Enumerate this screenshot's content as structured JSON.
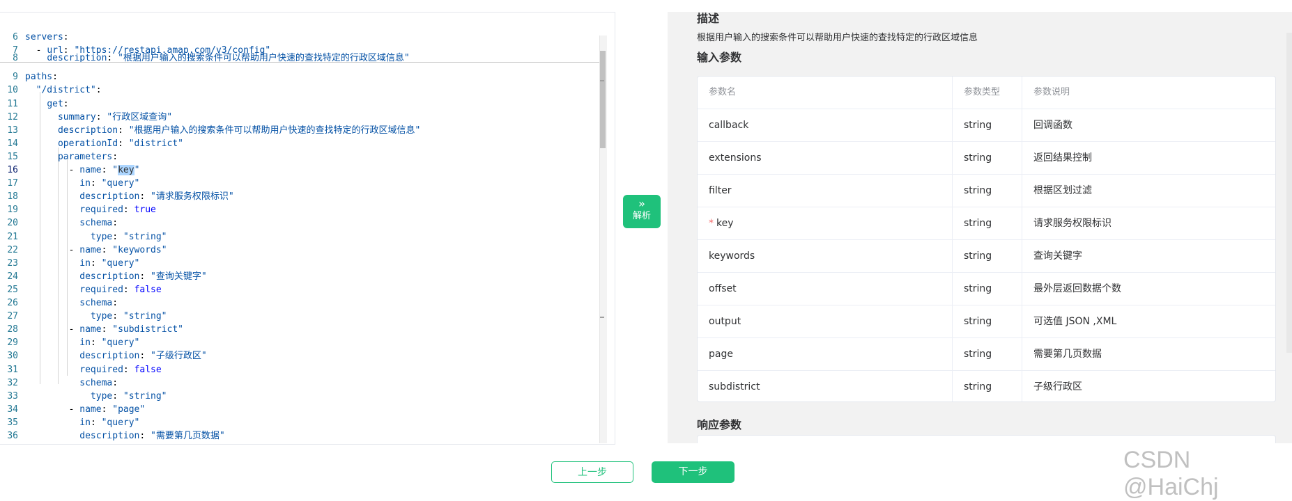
{
  "editor": {
    "lines": [
      {
        "n": "6",
        "parts": [
          [
            "k",
            "servers"
          ],
          [
            "p",
            ":"
          ]
        ]
      },
      {
        "n": "7",
        "parts": [
          [
            "p",
            "  - "
          ],
          [
            "k",
            "url"
          ],
          [
            "p",
            ": "
          ],
          [
            "s",
            "\"https://restapi.amap.com/v3/config\""
          ]
        ]
      },
      {
        "n": "8",
        "parts": [
          [
            "p",
            "    "
          ],
          [
            "k",
            "description"
          ],
          [
            "p",
            ": "
          ],
          [
            "s",
            "\"根据用户输入的搜索条件可以帮助用户快速的查找特定的行政区域信息\""
          ]
        ]
      },
      {
        "n": "9",
        "parts": [
          [
            "k",
            "paths"
          ],
          [
            "p",
            ":"
          ]
        ]
      },
      {
        "n": "10",
        "parts": [
          [
            "p",
            "  "
          ],
          [
            "s",
            "\"/district\""
          ],
          [
            "p",
            ":"
          ]
        ]
      },
      {
        "n": "11",
        "parts": [
          [
            "p",
            "    "
          ],
          [
            "k",
            "get"
          ],
          [
            "p",
            ":"
          ]
        ]
      },
      {
        "n": "12",
        "parts": [
          [
            "p",
            "      "
          ],
          [
            "k",
            "summary"
          ],
          [
            "p",
            ": "
          ],
          [
            "s",
            "\"行政区域查询\""
          ]
        ]
      },
      {
        "n": "13",
        "parts": [
          [
            "p",
            "      "
          ],
          [
            "k",
            "description"
          ],
          [
            "p",
            ": "
          ],
          [
            "s",
            "\"根据用户输入的搜索条件可以帮助用户快速的查找特定的行政区域信息\""
          ]
        ]
      },
      {
        "n": "14",
        "parts": [
          [
            "p",
            "      "
          ],
          [
            "k",
            "operationId"
          ],
          [
            "p",
            ": "
          ],
          [
            "s",
            "\"district\""
          ]
        ]
      },
      {
        "n": "15",
        "parts": [
          [
            "p",
            "      "
          ],
          [
            "k",
            "parameters"
          ],
          [
            "p",
            ":"
          ]
        ]
      },
      {
        "n": "16",
        "cur": true,
        "parts": [
          [
            "p",
            "        - "
          ],
          [
            "k",
            "name"
          ],
          [
            "p",
            ": "
          ],
          [
            "s",
            "\""
          ],
          [
            "sel",
            "key"
          ],
          [
            "s",
            "\""
          ]
        ]
      },
      {
        "n": "17",
        "parts": [
          [
            "p",
            "          "
          ],
          [
            "k",
            "in"
          ],
          [
            "p",
            ": "
          ],
          [
            "s",
            "\"query\""
          ]
        ]
      },
      {
        "n": "18",
        "parts": [
          [
            "p",
            "          "
          ],
          [
            "k",
            "description"
          ],
          [
            "p",
            ": "
          ],
          [
            "s",
            "\"请求服务权限标识\""
          ]
        ]
      },
      {
        "n": "19",
        "parts": [
          [
            "p",
            "          "
          ],
          [
            "k",
            "required"
          ],
          [
            "p",
            ": "
          ],
          [
            "b",
            "true"
          ]
        ]
      },
      {
        "n": "20",
        "parts": [
          [
            "p",
            "          "
          ],
          [
            "k",
            "schema"
          ],
          [
            "p",
            ":"
          ]
        ]
      },
      {
        "n": "21",
        "parts": [
          [
            "p",
            "            "
          ],
          [
            "k",
            "type"
          ],
          [
            "p",
            ": "
          ],
          [
            "s",
            "\"string\""
          ]
        ]
      },
      {
        "n": "22",
        "parts": [
          [
            "p",
            "        - "
          ],
          [
            "k",
            "name"
          ],
          [
            "p",
            ": "
          ],
          [
            "s",
            "\"keywords\""
          ]
        ]
      },
      {
        "n": "23",
        "parts": [
          [
            "p",
            "          "
          ],
          [
            "k",
            "in"
          ],
          [
            "p",
            ": "
          ],
          [
            "s",
            "\"query\""
          ]
        ]
      },
      {
        "n": "24",
        "parts": [
          [
            "p",
            "          "
          ],
          [
            "k",
            "description"
          ],
          [
            "p",
            ": "
          ],
          [
            "s",
            "\"查询关键字\""
          ]
        ]
      },
      {
        "n": "25",
        "parts": [
          [
            "p",
            "          "
          ],
          [
            "k",
            "required"
          ],
          [
            "p",
            ": "
          ],
          [
            "b",
            "false"
          ]
        ]
      },
      {
        "n": "26",
        "parts": [
          [
            "p",
            "          "
          ],
          [
            "k",
            "schema"
          ],
          [
            "p",
            ":"
          ]
        ]
      },
      {
        "n": "27",
        "parts": [
          [
            "p",
            "            "
          ],
          [
            "k",
            "type"
          ],
          [
            "p",
            ": "
          ],
          [
            "s",
            "\"string\""
          ]
        ]
      },
      {
        "n": "28",
        "parts": [
          [
            "p",
            "        - "
          ],
          [
            "k",
            "name"
          ],
          [
            "p",
            ": "
          ],
          [
            "s",
            "\"subdistrict\""
          ]
        ]
      },
      {
        "n": "29",
        "parts": [
          [
            "p",
            "          "
          ],
          [
            "k",
            "in"
          ],
          [
            "p",
            ": "
          ],
          [
            "s",
            "\"query\""
          ]
        ]
      },
      {
        "n": "30",
        "parts": [
          [
            "p",
            "          "
          ],
          [
            "k",
            "description"
          ],
          [
            "p",
            ": "
          ],
          [
            "s",
            "\"子级行政区\""
          ]
        ]
      },
      {
        "n": "31",
        "parts": [
          [
            "p",
            "          "
          ],
          [
            "k",
            "required"
          ],
          [
            "p",
            ": "
          ],
          [
            "b",
            "false"
          ]
        ]
      },
      {
        "n": "32",
        "parts": [
          [
            "p",
            "          "
          ],
          [
            "k",
            "schema"
          ],
          [
            "p",
            ":"
          ]
        ]
      },
      {
        "n": "33",
        "parts": [
          [
            "p",
            "            "
          ],
          [
            "k",
            "type"
          ],
          [
            "p",
            ": "
          ],
          [
            "s",
            "\"string\""
          ]
        ]
      },
      {
        "n": "34",
        "parts": [
          [
            "p",
            "        - "
          ],
          [
            "k",
            "name"
          ],
          [
            "p",
            ": "
          ],
          [
            "s",
            "\"page\""
          ]
        ]
      },
      {
        "n": "35",
        "parts": [
          [
            "p",
            "          "
          ],
          [
            "k",
            "in"
          ],
          [
            "p",
            ": "
          ],
          [
            "s",
            "\"query\""
          ]
        ]
      },
      {
        "n": "36",
        "parts": [
          [
            "p",
            "          "
          ],
          [
            "k",
            "description"
          ],
          [
            "p",
            ": "
          ],
          [
            "s",
            "\"需要第几页数据\""
          ]
        ]
      }
    ]
  },
  "parse_button": {
    "chevron": "»",
    "label": "解析"
  },
  "right": {
    "desc_title": "描述",
    "desc_text": "根据用户输入的搜索条件可以帮助用户快速的查找特定的行政区域信息",
    "input_title": "输入参数",
    "headers": [
      "参数名",
      "参数类型",
      "参数说明"
    ],
    "rows": [
      {
        "name": "callback",
        "type": "string",
        "desc": "回调函数",
        "required": false
      },
      {
        "name": "extensions",
        "type": "string",
        "desc": "返回结果控制",
        "required": false
      },
      {
        "name": "filter",
        "type": "string",
        "desc": "根据区划过滤",
        "required": false
      },
      {
        "name": "key",
        "type": "string",
        "desc": "请求服务权限标识",
        "required": true
      },
      {
        "name": "keywords",
        "type": "string",
        "desc": "查询关键字",
        "required": false
      },
      {
        "name": "offset",
        "type": "string",
        "desc": "最外层返回数据个数",
        "required": false
      },
      {
        "name": "output",
        "type": "string",
        "desc": "可选值 JSON ,XML",
        "required": false
      },
      {
        "name": "page",
        "type": "string",
        "desc": "需要第几页数据",
        "required": false
      },
      {
        "name": "subdistrict",
        "type": "string",
        "desc": "子级行政区",
        "required": false
      }
    ],
    "required_mark": "*",
    "response_title": "响应参数"
  },
  "footer": {
    "prev": "上一步",
    "next": "下一步"
  },
  "watermark": "CSDN @HaiChj",
  "colors": {
    "accent": "#1fc17b",
    "required": "#f56c6c"
  }
}
